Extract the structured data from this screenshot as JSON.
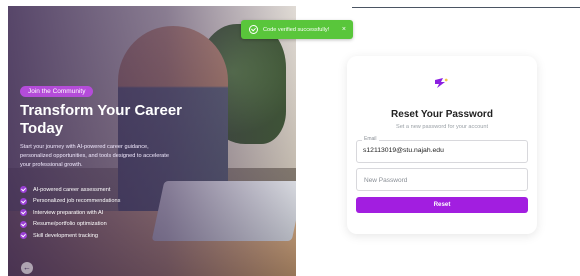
{
  "colors": {
    "accent": "#a21ee0",
    "toast": "#59c63b",
    "pill": "#b44cd9"
  },
  "toast": {
    "icon": "check-circle-icon",
    "message": "Code verified successfully!",
    "close": "×"
  },
  "hero": {
    "badge": "Join the Community",
    "title": "Transform Your Career Today",
    "description": "Start your journey with AI-powered career guidance, personalized opportunities, and tools designed to accelerate your professional growth.",
    "features": [
      {
        "icon": "check-icon",
        "label": "AI-powered career assessment"
      },
      {
        "icon": "check-icon",
        "label": "Personalized job recommendations"
      },
      {
        "icon": "check-icon",
        "label": "Interview preparation with AI"
      },
      {
        "icon": "check-icon",
        "label": "Resume/portfolio optimization"
      },
      {
        "icon": "check-icon",
        "label": "Skill development tracking"
      }
    ],
    "back_icon": "arrow-left-icon",
    "back_glyph": "←"
  },
  "form": {
    "logo_icon": "brand-logo-icon",
    "title": "Reset Your Password",
    "subtitle": "Set a new password for your account",
    "email_label": "Email",
    "email_value": "s12113019@stu.najah.edu",
    "password_placeholder": "New Password",
    "submit_label": "Reset"
  }
}
